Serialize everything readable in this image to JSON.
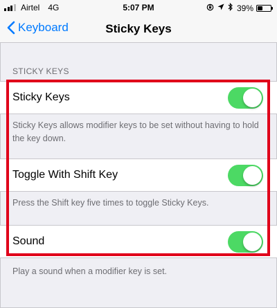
{
  "status_bar": {
    "carrier": "Airtel",
    "network": "4G",
    "time": "5:07 PM",
    "battery_percent": "39%",
    "battery_level": 0.39
  },
  "nav": {
    "back_label": "Keyboard",
    "title": "Sticky Keys"
  },
  "section_header": "STICKY KEYS",
  "settings": [
    {
      "label": "Sticky Keys",
      "enabled": true,
      "footer": "Sticky Keys allows modifier keys to be set without having to hold the key down."
    },
    {
      "label": "Toggle With Shift Key",
      "enabled": true,
      "footer": "Press the Shift key five times to toggle Sticky Keys."
    },
    {
      "label": "Sound",
      "enabled": true,
      "footer": "Play a sound when a modifier key is set."
    }
  ],
  "colors": {
    "toggle_on": "#4cd964",
    "accent": "#007aff",
    "highlight_border": "#e0001a"
  }
}
